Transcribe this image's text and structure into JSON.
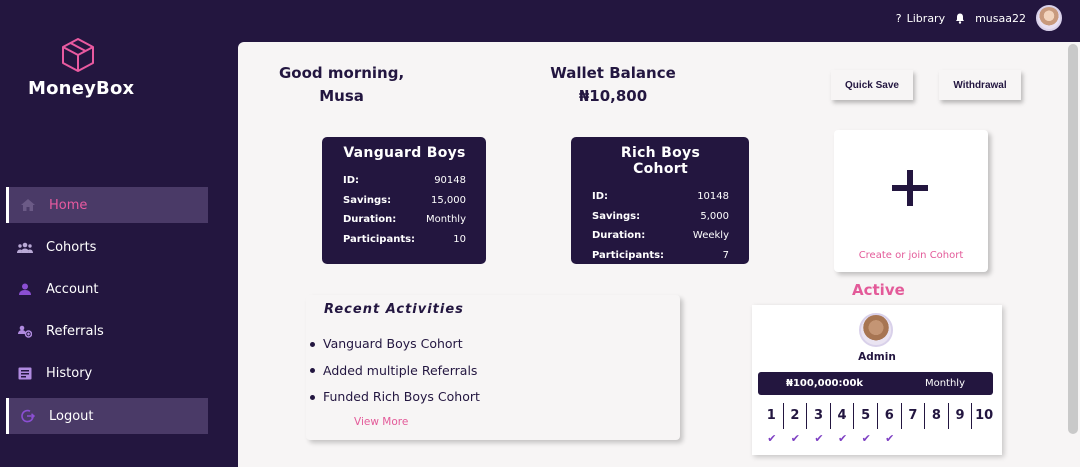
{
  "topbar": {
    "library_label": "Library",
    "username": "musaa22",
    "icons": [
      "question-icon",
      "bell-icon",
      "avatar"
    ]
  },
  "sidebar": {
    "brand": "MoneyBox",
    "items": [
      {
        "label": "Home",
        "icon": "home-icon",
        "active": true
      },
      {
        "label": "Cohorts",
        "icon": "users-icon"
      },
      {
        "label": "Account",
        "icon": "account-icon"
      },
      {
        "label": "Referrals",
        "icon": "referrals-icon"
      },
      {
        "label": "History",
        "icon": "history-icon"
      },
      {
        "label": "Logout",
        "icon": "logout-icon"
      }
    ]
  },
  "greeting": {
    "line1": "Good morning,",
    "line2": "Musa"
  },
  "wallet": {
    "title": "Wallet Balance",
    "amount": "₦10,800"
  },
  "buttons": {
    "quick_save": "Quick Save",
    "withdrawal": "Withdrawal"
  },
  "cohorts": [
    {
      "title": "Vanguard Boys",
      "rows": [
        {
          "key": "ID:",
          "value": "90148"
        },
        {
          "key": "Savings:",
          "value": "15,000"
        },
        {
          "key": "Duration:",
          "value": "Monthly"
        },
        {
          "key": "Participants:",
          "value": "10"
        }
      ]
    },
    {
      "title": "Rich Boys Cohort",
      "rows": [
        {
          "key": "ID:",
          "value": "10148"
        },
        {
          "key": "Savings:",
          "value": "5,000"
        },
        {
          "key": "Duration:",
          "value": "Weekly"
        },
        {
          "key": "Participants:",
          "value": "7"
        }
      ]
    }
  ],
  "create_cohort": {
    "label": "Create or join Cohort"
  },
  "recent": {
    "title": "Recent Activities",
    "items": [
      "Vanguard Boys Cohort",
      "Added multiple Referrals",
      "Funded Rich Boys Cohort"
    ],
    "view_more": "View More"
  },
  "active": {
    "title": "Active",
    "role": "Admin",
    "amount": "₦100,000:00k",
    "frequency": "Monthly",
    "slots": [
      "1",
      "2",
      "3",
      "4",
      "5",
      "6",
      "7",
      "8",
      "9",
      "10"
    ],
    "paid": [
      "✔",
      "✔",
      "✔",
      "✔",
      "✔",
      "✔",
      "",
      "",
      "",
      ""
    ]
  },
  "colors": {
    "primary": "#23163f",
    "accent": "#e35a99",
    "check": "#7d3fc3",
    "panel": "#f7f5f5"
  }
}
